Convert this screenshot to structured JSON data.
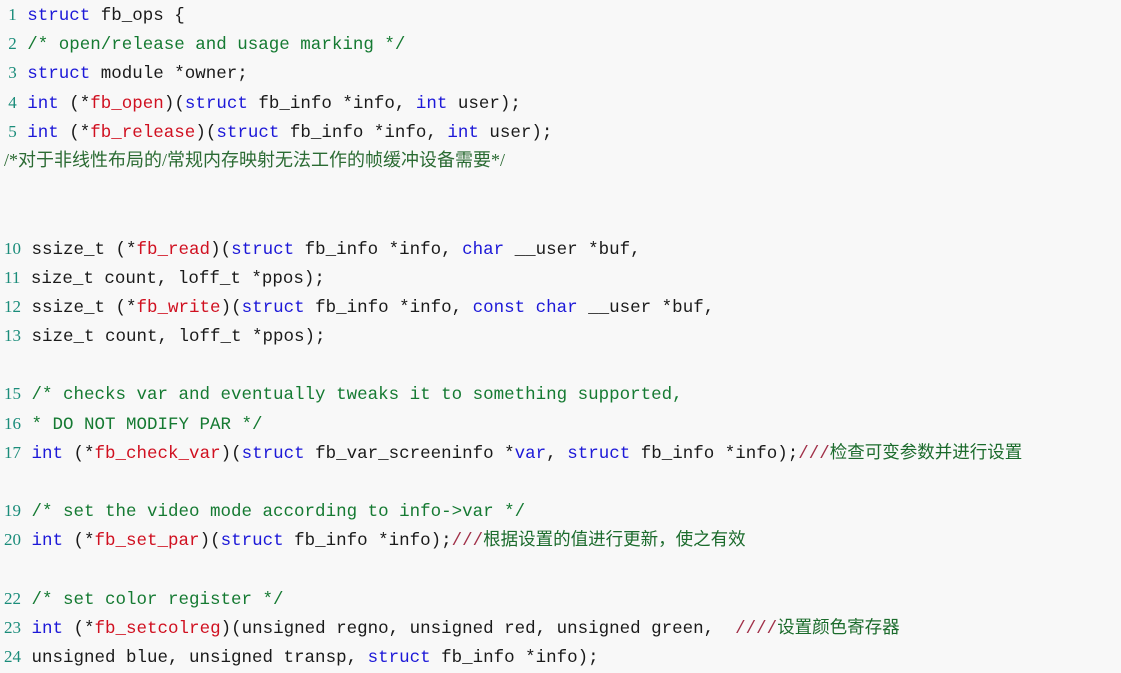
{
  "document": {
    "title": "fb_ops structure definition",
    "language": "C",
    "background_color": "#f8f8f8"
  },
  "colors": {
    "line_number": "#1a8c7a",
    "keyword": "#1c18d8",
    "function_name": "#d01020",
    "plain_text": "#1a1a1a",
    "comment": "#157a32",
    "comment_marker": "#a03048",
    "chinese_comment": "#1b6b2c"
  },
  "lines": [
    {
      "number": "1",
      "segments": [
        {
          "cls": "kw",
          "text": "struct"
        },
        {
          "cls": "plain",
          "text": " fb_ops {"
        }
      ]
    },
    {
      "number": "2",
      "segments": [
        {
          "cls": "cmt",
          "text": "/* open/release and usage marking */"
        }
      ]
    },
    {
      "number": "3",
      "segments": [
        {
          "cls": "kw",
          "text": "struct"
        },
        {
          "cls": "plain",
          "text": " module *owner;"
        }
      ]
    },
    {
      "number": "4",
      "segments": [
        {
          "cls": "kw",
          "text": "int"
        },
        {
          "cls": "plain",
          "text": " (*"
        },
        {
          "cls": "fn",
          "text": "fb_open"
        },
        {
          "cls": "plain",
          "text": ")("
        },
        {
          "cls": "kw",
          "text": "struct"
        },
        {
          "cls": "plain",
          "text": " fb_info *info, "
        },
        {
          "cls": "kw",
          "text": "int"
        },
        {
          "cls": "plain",
          "text": " user);"
        }
      ]
    },
    {
      "number": "5",
      "segments": [
        {
          "cls": "kw",
          "text": "int"
        },
        {
          "cls": "plain",
          "text": " (*"
        },
        {
          "cls": "fn",
          "text": "fb_release"
        },
        {
          "cls": "plain",
          "text": ")("
        },
        {
          "cls": "kw",
          "text": "struct"
        },
        {
          "cls": "plain",
          "text": " fb_info *info, "
        },
        {
          "cls": "kw",
          "text": "int"
        },
        {
          "cls": "plain",
          "text": " user);"
        }
      ]
    },
    {
      "number": "",
      "segments": [
        {
          "cls": "cn-full",
          "text": "/*对于非线性布局的/常规内存映射无法工作的帧缓冲设备需要*/"
        }
      ]
    },
    {
      "number": "",
      "segments": [],
      "blank": true
    },
    {
      "number": "",
      "segments": [],
      "blank": true
    },
    {
      "number": "10",
      "segments": [
        {
          "cls": "plain",
          "text": "ssize_t (*"
        },
        {
          "cls": "fn",
          "text": "fb_read"
        },
        {
          "cls": "plain",
          "text": ")("
        },
        {
          "cls": "kw",
          "text": "struct"
        },
        {
          "cls": "plain",
          "text": " fb_info *info, "
        },
        {
          "cls": "kw",
          "text": "char"
        },
        {
          "cls": "plain",
          "text": " __user *buf,"
        }
      ]
    },
    {
      "number": "11",
      "segments": [
        {
          "cls": "plain",
          "text": "size_t count, loff_t *ppos);"
        }
      ]
    },
    {
      "number": "12",
      "segments": [
        {
          "cls": "plain",
          "text": "ssize_t (*"
        },
        {
          "cls": "fn",
          "text": "fb_write"
        },
        {
          "cls": "plain",
          "text": ")("
        },
        {
          "cls": "kw",
          "text": "struct"
        },
        {
          "cls": "plain",
          "text": " fb_info *info, "
        },
        {
          "cls": "kw",
          "text": "const"
        },
        {
          "cls": "plain",
          "text": " "
        },
        {
          "cls": "kw",
          "text": "char"
        },
        {
          "cls": "plain",
          "text": " __user *buf,"
        }
      ]
    },
    {
      "number": "13",
      "segments": [
        {
          "cls": "plain",
          "text": "size_t count, loff_t *ppos);"
        }
      ]
    },
    {
      "number": "",
      "segments": [],
      "blank": true
    },
    {
      "number": "15",
      "segments": [
        {
          "cls": "cmt",
          "text": "/* checks var and eventually tweaks it to something supported,"
        }
      ]
    },
    {
      "number": "16",
      "segments": [
        {
          "cls": "cmt",
          "text": "* DO NOT MODIFY PAR */"
        }
      ]
    },
    {
      "number": "17",
      "segments": [
        {
          "cls": "kw",
          "text": "int"
        },
        {
          "cls": "plain",
          "text": " (*"
        },
        {
          "cls": "fn",
          "text": "fb_check_var"
        },
        {
          "cls": "plain",
          "text": ")("
        },
        {
          "cls": "kw",
          "text": "struct"
        },
        {
          "cls": "plain",
          "text": " fb_var_screeninfo *"
        },
        {
          "cls": "kw",
          "text": "var"
        },
        {
          "cls": "plain",
          "text": ", "
        },
        {
          "cls": "kw",
          "text": "struct"
        },
        {
          "cls": "plain",
          "text": " fb_info *info);"
        },
        {
          "cls": "cmtmark",
          "text": "///"
        },
        {
          "cls": "cn",
          "text": "检查可变参数并进行设置"
        }
      ]
    },
    {
      "number": "",
      "segments": [],
      "blank": true
    },
    {
      "number": "19",
      "segments": [
        {
          "cls": "cmt",
          "text": "/* set the video mode according to info->var */"
        }
      ]
    },
    {
      "number": "20",
      "segments": [
        {
          "cls": "kw",
          "text": "int"
        },
        {
          "cls": "plain",
          "text": " (*"
        },
        {
          "cls": "fn",
          "text": "fb_set_par"
        },
        {
          "cls": "plain",
          "text": ")("
        },
        {
          "cls": "kw",
          "text": "struct"
        },
        {
          "cls": "plain",
          "text": " fb_info *info);"
        },
        {
          "cls": "cmtmark",
          "text": "///"
        },
        {
          "cls": "cn",
          "text": "根据设置的值进行更新，使之有效"
        }
      ]
    },
    {
      "number": "",
      "segments": [],
      "blank": true
    },
    {
      "number": "22",
      "segments": [
        {
          "cls": "cmt",
          "text": "/* set color register */"
        }
      ]
    },
    {
      "number": "23",
      "segments": [
        {
          "cls": "kw",
          "text": "int"
        },
        {
          "cls": "plain",
          "text": " (*"
        },
        {
          "cls": "fn",
          "text": "fb_setcolreg"
        },
        {
          "cls": "plain",
          "text": ")(unsigned regno, unsigned red, unsigned green,  "
        },
        {
          "cls": "cmtmark",
          "text": "////"
        },
        {
          "cls": "cn",
          "text": "设置颜色寄存器"
        }
      ]
    },
    {
      "number": "24",
      "segments": [
        {
          "cls": "plain",
          "text": "unsigned blue, unsigned transp, "
        },
        {
          "cls": "kw",
          "text": "struct"
        },
        {
          "cls": "plain",
          "text": " fb_info *info);"
        }
      ]
    }
  ]
}
